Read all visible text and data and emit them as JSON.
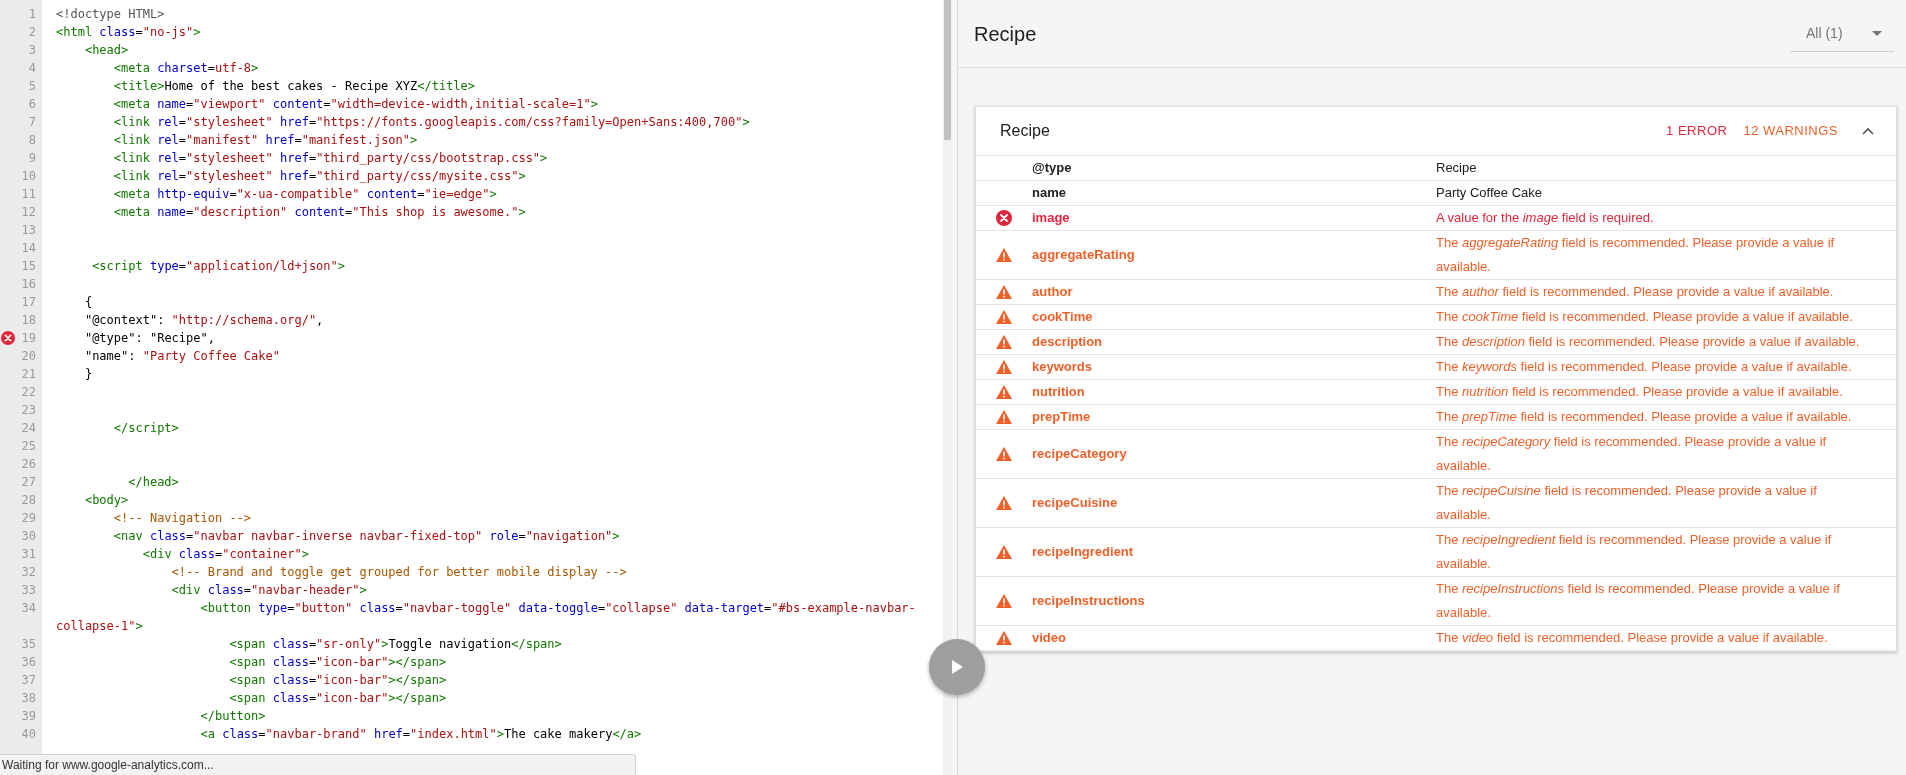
{
  "editor": {
    "lines": [
      {
        "number": "1",
        "error": false,
        "tokens": [
          {
            "kind": "meta",
            "text": "<!doctype HTML>"
          }
        ]
      },
      {
        "number": "2",
        "error": false,
        "tokens": [
          {
            "kind": "tag",
            "text": "<html"
          },
          {
            "kind": "attr",
            "text": " class"
          },
          {
            "kind": "text",
            "text": "="
          },
          {
            "kind": "string",
            "text": "\"no-js\""
          },
          {
            "kind": "tag",
            "text": ">"
          }
        ]
      },
      {
        "number": "3",
        "error": false,
        "tokens": [
          {
            "kind": "tag",
            "text": "    <head>"
          }
        ]
      },
      {
        "number": "4",
        "error": false,
        "tokens": [
          {
            "kind": "tag",
            "text": "        <meta"
          },
          {
            "kind": "attr",
            "text": " charset"
          },
          {
            "kind": "text",
            "text": "="
          },
          {
            "kind": "string",
            "text": "utf-8"
          },
          {
            "kind": "tag",
            "text": ">"
          }
        ]
      },
      {
        "number": "5",
        "error": false,
        "tokens": [
          {
            "kind": "tag",
            "text": "        <title>"
          },
          {
            "kind": "text",
            "text": "Home of the best cakes - Recipe XYZ"
          },
          {
            "kind": "tag",
            "text": "</title>"
          }
        ]
      },
      {
        "number": "6",
        "error": false,
        "tokens": [
          {
            "kind": "tag",
            "text": "        <meta"
          },
          {
            "kind": "attr",
            "text": " name"
          },
          {
            "kind": "text",
            "text": "="
          },
          {
            "kind": "string",
            "text": "\"viewport\""
          },
          {
            "kind": "attr",
            "text": " content"
          },
          {
            "kind": "text",
            "text": "="
          },
          {
            "kind": "string",
            "text": "\"width=device-width,initial-scale=1\""
          },
          {
            "kind": "tag",
            "text": ">"
          }
        ]
      },
      {
        "number": "7",
        "error": false,
        "tokens": [
          {
            "kind": "tag",
            "text": "        <link"
          },
          {
            "kind": "attr",
            "text": " rel"
          },
          {
            "kind": "text",
            "text": "="
          },
          {
            "kind": "string",
            "text": "\"stylesheet\""
          },
          {
            "kind": "attr",
            "text": " href"
          },
          {
            "kind": "text",
            "text": "="
          },
          {
            "kind": "string",
            "text": "\"https://fonts.googleapis.com/css?family=Open+Sans:400,700\""
          },
          {
            "kind": "tag",
            "text": ">"
          }
        ]
      },
      {
        "number": "8",
        "error": false,
        "tokens": [
          {
            "kind": "tag",
            "text": "        <link"
          },
          {
            "kind": "attr",
            "text": " rel"
          },
          {
            "kind": "text",
            "text": "="
          },
          {
            "kind": "string",
            "text": "\"manifest\""
          },
          {
            "kind": "attr",
            "text": " href"
          },
          {
            "kind": "text",
            "text": "="
          },
          {
            "kind": "string",
            "text": "\"manifest.json\""
          },
          {
            "kind": "tag",
            "text": ">"
          }
        ]
      },
      {
        "number": "9",
        "error": false,
        "tokens": [
          {
            "kind": "tag",
            "text": "        <link"
          },
          {
            "kind": "attr",
            "text": " rel"
          },
          {
            "kind": "text",
            "text": "="
          },
          {
            "kind": "string",
            "text": "\"stylesheet\""
          },
          {
            "kind": "attr",
            "text": " href"
          },
          {
            "kind": "text",
            "text": "="
          },
          {
            "kind": "string",
            "text": "\"third_party/css/bootstrap.css\""
          },
          {
            "kind": "tag",
            "text": ">"
          }
        ]
      },
      {
        "number": "10",
        "error": false,
        "tokens": [
          {
            "kind": "tag",
            "text": "        <link"
          },
          {
            "kind": "attr",
            "text": " rel"
          },
          {
            "kind": "text",
            "text": "="
          },
          {
            "kind": "string",
            "text": "\"stylesheet\""
          },
          {
            "kind": "attr",
            "text": " href"
          },
          {
            "kind": "text",
            "text": "="
          },
          {
            "kind": "string",
            "text": "\"third_party/css/mysite.css\""
          },
          {
            "kind": "tag",
            "text": ">"
          }
        ]
      },
      {
        "number": "11",
        "error": false,
        "tokens": [
          {
            "kind": "tag",
            "text": "        <meta"
          },
          {
            "kind": "attr",
            "text": " http-equiv"
          },
          {
            "kind": "text",
            "text": "="
          },
          {
            "kind": "string",
            "text": "\"x-ua-compatible\""
          },
          {
            "kind": "attr",
            "text": " content"
          },
          {
            "kind": "text",
            "text": "="
          },
          {
            "kind": "string",
            "text": "\"ie=edge\""
          },
          {
            "kind": "tag",
            "text": ">"
          }
        ]
      },
      {
        "number": "12",
        "error": false,
        "tokens": [
          {
            "kind": "tag",
            "text": "        <meta"
          },
          {
            "kind": "attr",
            "text": " name"
          },
          {
            "kind": "text",
            "text": "="
          },
          {
            "kind": "string",
            "text": "\"description\""
          },
          {
            "kind": "attr",
            "text": " content"
          },
          {
            "kind": "text",
            "text": "="
          },
          {
            "kind": "string",
            "text": "\"This shop is awesome.\""
          },
          {
            "kind": "tag",
            "text": ">"
          }
        ]
      },
      {
        "number": "13",
        "error": false
      },
      {
        "number": "14",
        "error": false
      },
      {
        "number": "15",
        "error": false,
        "tokens": [
          {
            "kind": "tag",
            "text": "     <script"
          },
          {
            "kind": "attr",
            "text": " type"
          },
          {
            "kind": "text",
            "text": "="
          },
          {
            "kind": "string",
            "text": "\"application/ld+json\""
          },
          {
            "kind": "tag",
            "text": ">"
          }
        ]
      },
      {
        "number": "16",
        "error": false
      },
      {
        "number": "17",
        "error": false,
        "tokens": [
          {
            "kind": "text",
            "text": "    {"
          }
        ]
      },
      {
        "number": "18",
        "error": false,
        "tokens": [
          {
            "kind": "text",
            "text": "    \"@context\": "
          },
          {
            "kind": "string",
            "text": "\"http://schema.org/\""
          },
          {
            "kind": "text",
            "text": ","
          }
        ]
      },
      {
        "number": "19",
        "error": true,
        "tokens": [
          {
            "kind": "text",
            "text": "    \"@type\": \"Recipe\","
          }
        ]
      },
      {
        "number": "20",
        "error": false,
        "tokens": [
          {
            "kind": "text",
            "text": "    \"name\": "
          },
          {
            "kind": "string",
            "text": "\"Party Coffee Cake\""
          }
        ]
      },
      {
        "number": "21",
        "error": false,
        "tokens": [
          {
            "kind": "text",
            "text": "    }"
          }
        ]
      },
      {
        "number": "22",
        "error": false
      },
      {
        "number": "23",
        "error": false
      },
      {
        "number": "24",
        "error": false,
        "tokens": [
          {
            "kind": "tag",
            "text": "        </script>"
          }
        ]
      },
      {
        "number": "25",
        "error": false
      },
      {
        "number": "26",
        "error": false
      },
      {
        "number": "27",
        "error": false,
        "tokens": [
          {
            "kind": "tag",
            "text": "          </head>"
          }
        ]
      },
      {
        "number": "28",
        "error": false,
        "tokens": [
          {
            "kind": "tag",
            "text": "    <body>"
          }
        ]
      },
      {
        "number": "29",
        "error": false,
        "tokens": [
          {
            "kind": "comment",
            "text": "        <!-- Navigation -->"
          }
        ]
      },
      {
        "number": "30",
        "error": false,
        "tokens": [
          {
            "kind": "tag",
            "text": "        <nav"
          },
          {
            "kind": "attr",
            "text": " class"
          },
          {
            "kind": "text",
            "text": "="
          },
          {
            "kind": "string",
            "text": "\"navbar navbar-inverse navbar-fixed-top\""
          },
          {
            "kind": "attr",
            "text": " role"
          },
          {
            "kind": "text",
            "text": "="
          },
          {
            "kind": "string",
            "text": "\"navigation\""
          },
          {
            "kind": "tag",
            "text": ">"
          }
        ]
      },
      {
        "number": "31",
        "error": false,
        "tokens": [
          {
            "kind": "tag",
            "text": "            <div"
          },
          {
            "kind": "attr",
            "text": " class"
          },
          {
            "kind": "text",
            "text": "="
          },
          {
            "kind": "string",
            "text": "\"container\""
          },
          {
            "kind": "tag",
            "text": ">"
          }
        ]
      },
      {
        "number": "32",
        "error": false,
        "tokens": [
          {
            "kind": "comment",
            "text": "                <!-- Brand and toggle get grouped for better mobile display -->"
          }
        ]
      },
      {
        "number": "33",
        "error": false,
        "tokens": [
          {
            "kind": "tag",
            "text": "                <div"
          },
          {
            "kind": "attr",
            "text": " class"
          },
          {
            "kind": "text",
            "text": "="
          },
          {
            "kind": "string",
            "text": "\"navbar-header\""
          },
          {
            "kind": "tag",
            "text": ">"
          }
        ]
      },
      {
        "number": "34",
        "error": false,
        "tokens": [
          {
            "kind": "tag",
            "text": "                    <button"
          },
          {
            "kind": "attr",
            "text": " type"
          },
          {
            "kind": "text",
            "text": "="
          },
          {
            "kind": "string",
            "text": "\"button\""
          },
          {
            "kind": "attr",
            "text": " class"
          },
          {
            "kind": "text",
            "text": "="
          },
          {
            "kind": "string",
            "text": "\"navbar-toggle\""
          },
          {
            "kind": "attr",
            "text": " data-toggle"
          },
          {
            "kind": "text",
            "text": "="
          },
          {
            "kind": "string",
            "text": "\"collapse\""
          },
          {
            "kind": "attr",
            "text": " data-target"
          },
          {
            "kind": "text",
            "text": "="
          },
          {
            "kind": "string",
            "text": "\"#bs-example-navbar-collapse-1\""
          },
          {
            "kind": "tag",
            "text": ">"
          }
        ]
      },
      {
        "number": "35",
        "error": false,
        "tokens": [
          {
            "kind": "tag",
            "text": "                        <span"
          },
          {
            "kind": "attr",
            "text": " class"
          },
          {
            "kind": "text",
            "text": "="
          },
          {
            "kind": "string",
            "text": "\"sr-only\""
          },
          {
            "kind": "tag",
            "text": ">"
          },
          {
            "kind": "text",
            "text": "Toggle navigation"
          },
          {
            "kind": "tag",
            "text": "</span>"
          }
        ]
      },
      {
        "number": "36",
        "error": false,
        "tokens": [
          {
            "kind": "tag",
            "text": "                        <span"
          },
          {
            "kind": "attr",
            "text": " class"
          },
          {
            "kind": "text",
            "text": "="
          },
          {
            "kind": "string",
            "text": "\"icon-bar\""
          },
          {
            "kind": "tag",
            "text": "></span>"
          }
        ]
      },
      {
        "number": "37",
        "error": false,
        "tokens": [
          {
            "kind": "tag",
            "text": "                        <span"
          },
          {
            "kind": "attr",
            "text": " class"
          },
          {
            "kind": "text",
            "text": "="
          },
          {
            "kind": "string",
            "text": "\"icon-bar\""
          },
          {
            "kind": "tag",
            "text": "></span>"
          }
        ]
      },
      {
        "number": "38",
        "error": false,
        "tokens": [
          {
            "kind": "tag",
            "text": "                        <span"
          },
          {
            "kind": "attr",
            "text": " class"
          },
          {
            "kind": "text",
            "text": "="
          },
          {
            "kind": "string",
            "text": "\"icon-bar\""
          },
          {
            "kind": "tag",
            "text": "></span>"
          }
        ]
      },
      {
        "number": "39",
        "error": false,
        "tokens": [
          {
            "kind": "tag",
            "text": "                    </button>"
          }
        ]
      },
      {
        "number": "40",
        "error": false,
        "tokens": [
          {
            "kind": "tag",
            "text": "                    <a"
          },
          {
            "kind": "attr",
            "text": " class"
          },
          {
            "kind": "text",
            "text": "="
          },
          {
            "kind": "string",
            "text": "\"navbar-brand\""
          },
          {
            "kind": "attr",
            "text": " href"
          },
          {
            "kind": "text",
            "text": "="
          },
          {
            "kind": "string",
            "text": "\"index.html\""
          },
          {
            "kind": "tag",
            "text": ">"
          },
          {
            "kind": "text",
            "text": "The cake makery"
          },
          {
            "kind": "tag",
            "text": "</a>"
          }
        ]
      }
    ]
  },
  "status_bar": "Waiting for www.google-analytics.com...",
  "results": {
    "title": "Recipe",
    "filter": "All (1)",
    "card": {
      "title": "Recipe",
      "errors": "1 ERROR",
      "warnings": "12 WARNINGS",
      "expanded": true,
      "rows": [
        {
          "property": "@type",
          "value": "Recipe",
          "kind": "ok"
        },
        {
          "property": "name",
          "value": "Party Coffee Cake",
          "kind": "ok"
        },
        {
          "property": "image",
          "value": "A value for the *image* field is required.",
          "kind": "error"
        },
        {
          "property": "aggregateRating",
          "value": "The *aggregateRating* field is recommended. Please provide a value if available.",
          "kind": "warning"
        },
        {
          "property": "author",
          "value": "The *author* field is recommended. Please provide a value if available.",
          "kind": "warning"
        },
        {
          "property": "cookTime",
          "value": "The *cookTime* field is recommended. Please provide a value if available.",
          "kind": "warning"
        },
        {
          "property": "description",
          "value": "The *description* field is recommended. Please provide a value if available.",
          "kind": "warning"
        },
        {
          "property": "keywords",
          "value": "The *keywords* field is recommended. Please provide a value if available.",
          "kind": "warning"
        },
        {
          "property": "nutrition",
          "value": "The *nutrition* field is recommended. Please provide a value if available.",
          "kind": "warning"
        },
        {
          "property": "prepTime",
          "value": "The *prepTime* field is recommended. Please provide a value if available.",
          "kind": "warning"
        },
        {
          "property": "recipeCategory",
          "value": "The *recipeCategory* field is recommended. Please provide a value if available.",
          "kind": "warning"
        },
        {
          "property": "recipeCuisine",
          "value": "The *recipeCuisine* field is recommended. Please provide a value if available.",
          "kind": "warning"
        },
        {
          "property": "recipeIngredient",
          "value": "The *recipeIngredient* field is recommended. Please provide a value if available.",
          "kind": "warning"
        },
        {
          "property": "recipeInstructions",
          "value": "The *recipeInstructions* field is recommended. Please provide a value if available.",
          "kind": "warning"
        },
        {
          "property": "video",
          "value": "The *video* field is recommended. Please provide a value if available.",
          "kind": "warning"
        }
      ]
    }
  }
}
